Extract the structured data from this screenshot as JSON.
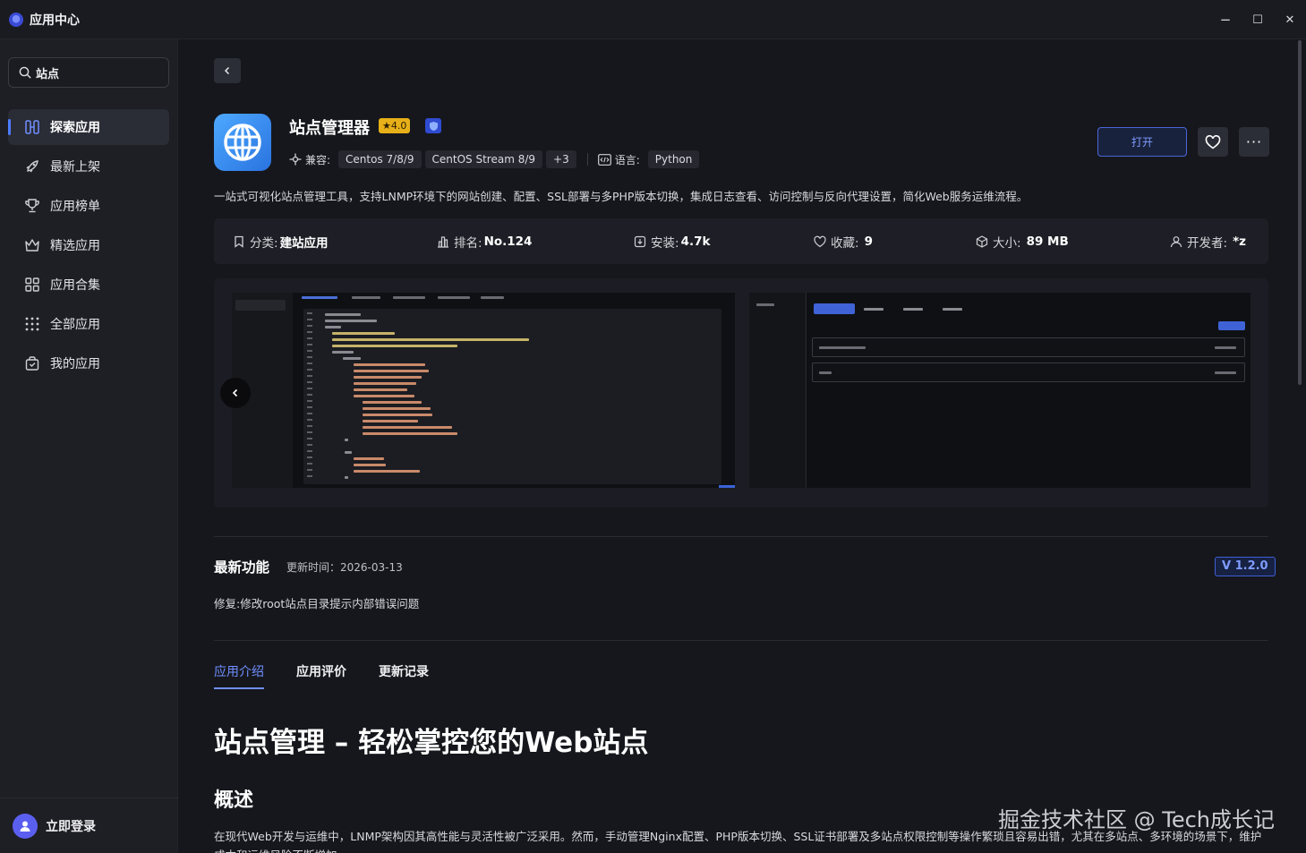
{
  "window": {
    "title": "应用中心",
    "minimize": "−",
    "maximize": "☐",
    "close": "✕"
  },
  "sidebar": {
    "search_value": "站点",
    "items": [
      {
        "label": "探索应用",
        "icon": "explore-icon"
      },
      {
        "label": "最新上架",
        "icon": "rocket-icon"
      },
      {
        "label": "应用榜单",
        "icon": "trophy-icon"
      },
      {
        "label": "精选应用",
        "icon": "crown-icon"
      },
      {
        "label": "应用合集",
        "icon": "grid-icon"
      },
      {
        "label": "全部应用",
        "icon": "dots-grid-icon"
      },
      {
        "label": "我的应用",
        "icon": "bag-icon"
      }
    ],
    "login_label": "立即登录"
  },
  "app": {
    "name": "站点管理器",
    "rating": "★4.0",
    "compat_label": "兼容:",
    "compat_tags": [
      "Centos 7/8/9",
      "CentOS Stream 8/9",
      "+3"
    ],
    "lang_label": "语言:",
    "lang_tag": "Python",
    "open_label": "打开",
    "more_label": "···",
    "description": "一站式可视化站点管理工具，支持LNMP环境下的网站创建、配置、SSL部署与多PHP版本切换，集成日志查看、访问控制与反向代理设置，简化Web服务运维流程。"
  },
  "stats": [
    {
      "label": "分类:",
      "value": "建站应用",
      "icon": "bookmark-icon"
    },
    {
      "label": "排名:",
      "value": "No.124",
      "icon": "rank-icon"
    },
    {
      "label": "安装:",
      "value": "4.7k",
      "icon": "install-icon"
    },
    {
      "label": "收藏:",
      "value": "9",
      "icon": "heart-icon"
    },
    {
      "label": "大小:",
      "value": "89 MB",
      "icon": "box-icon"
    },
    {
      "label": "开发者:",
      "value": "*z",
      "icon": "user-icon"
    }
  ],
  "latest": {
    "title": "最新功能",
    "update_time": "更新时间：2026-03-13",
    "version": "V 1.2.0",
    "note": "修复:修改root站点目录提示内部错误问题"
  },
  "tabs": [
    "应用介绍",
    "应用评价",
    "更新记录"
  ],
  "content": {
    "h1": "站点管理 – 轻松掌控您的Web站点",
    "h2": "概述",
    "body": "在现代Web开发与运维中，LNMP架构因其高性能与灵活性被广泛采用。然而，手动管理Nginx配置、PHP版本切换、SSL证书部署及多站点权限控制等操作繁琐且容易出错，尤其在多站点、多环境的场景下，维护成本和运维风险不断增加。"
  },
  "watermark": "掘金技术社区 @ Tech成长记",
  "colors": {
    "accent": "#6f8fff",
    "rating": "#e7b019",
    "background": "#16171c",
    "sidebar": "#1e1f25"
  }
}
